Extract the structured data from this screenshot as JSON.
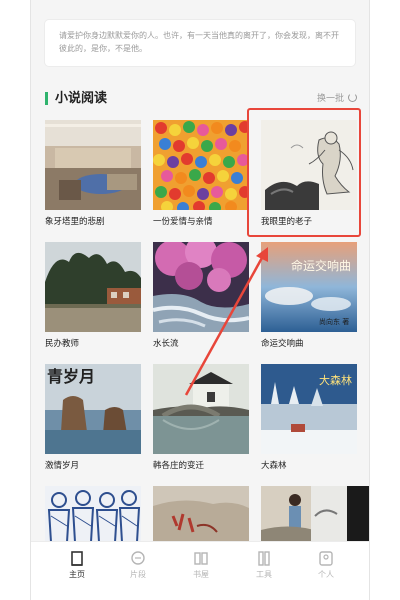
{
  "quote": {
    "text": "请爱护你身边默默爱你的人。也许，有一天当他真的离开了，你会发现，离不开彼此的，是你，不是他。"
  },
  "section": {
    "title": "小说阅读",
    "refresh_label": "换一批"
  },
  "books": [
    {
      "title": "象牙塔里的悲剧",
      "cover": "classroom-photo"
    },
    {
      "title": "一份爱情与亲情",
      "cover": "colorful-candies"
    },
    {
      "title": "我眼里的老子",
      "cover": "ink-painting-sage"
    },
    {
      "title": "民办教师",
      "cover": "village-school"
    },
    {
      "title": "水长流",
      "cover": "blossom-stream"
    },
    {
      "title": "命运交响曲",
      "cover": "sky-ocean-title",
      "cover_text": "命运交响曲",
      "author_text": "尚向东 著"
    },
    {
      "title": "激情岁月",
      "cover": "sea-rocks",
      "cover_text": "青岁月"
    },
    {
      "title": "韩各庄的变迁",
      "cover": "village-bridge"
    },
    {
      "title": "大森林",
      "cover": "snow-forest",
      "cover_text": "大森林"
    },
    {
      "title": "",
      "cover": "blue-figures"
    },
    {
      "title": "",
      "cover": "stone-carving"
    },
    {
      "title": "",
      "cover": "children-rocks"
    },
    {
      "title": "",
      "cover": "ink-dark"
    }
  ],
  "tabs": [
    {
      "label": "主页",
      "icon": "home-icon",
      "active": true
    },
    {
      "label": "片段",
      "icon": "chat-icon",
      "active": false
    },
    {
      "label": "书屋",
      "icon": "bookshelf-icon",
      "active": false
    },
    {
      "label": "工具",
      "icon": "tools-icon",
      "active": false
    },
    {
      "label": "个人",
      "icon": "profile-icon",
      "active": false
    }
  ],
  "colors": {
    "accent": "#2fb36d",
    "highlight": "#e8463a",
    "tab_inactive": "#b5b5b5"
  }
}
